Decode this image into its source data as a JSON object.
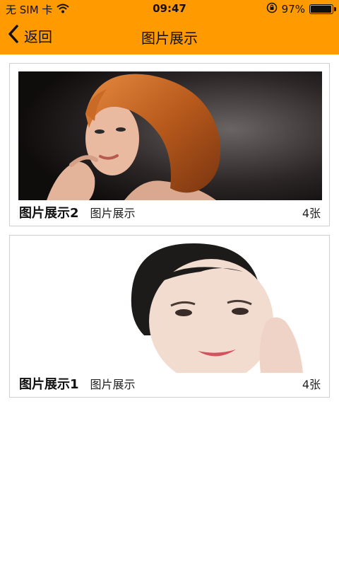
{
  "status": {
    "carrier": "无 SIM 卡",
    "time": "09:47",
    "battery": "97%",
    "battery_level": 0.97
  },
  "nav": {
    "back_label": "返回",
    "title": "图片展示"
  },
  "gallery": [
    {
      "name": "图片展示2",
      "subtitle": "图片展示",
      "count": "4张"
    },
    {
      "name": "图片展示1",
      "subtitle": "图片展示",
      "count": "4张"
    }
  ],
  "colors": {
    "accent": "#ff9a00",
    "card_border": "#cfcfcf"
  },
  "icons": {
    "back": "chevron-left-icon",
    "wifi": "wifi-icon",
    "rotation_lock": "rotation-lock-icon",
    "battery": "battery-icon"
  }
}
